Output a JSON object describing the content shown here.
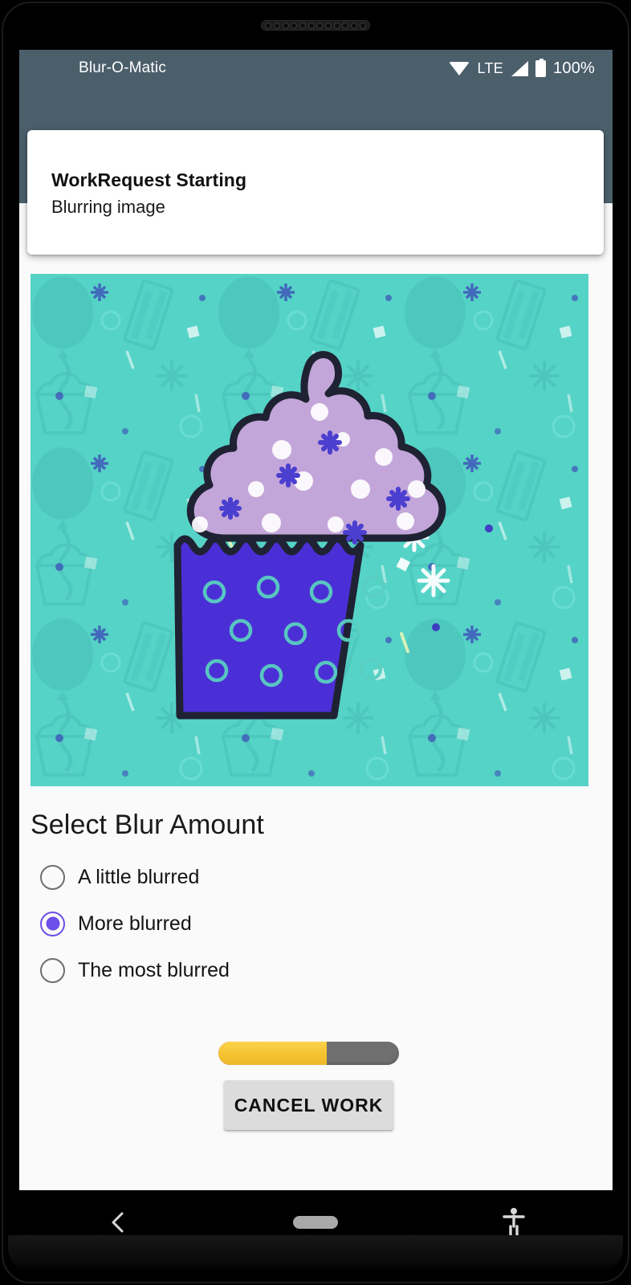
{
  "status_bar": {
    "app_title": "Blur-O-Matic",
    "network_label": "LTE",
    "battery_percent": "100%",
    "wifi_icon": "wifi-icon",
    "signal_icon": "signal-bars-icon",
    "battery_icon": "battery-full-icon",
    "background_color": "#4b5f6b"
  },
  "notification": {
    "title": "WorkRequest Starting",
    "body": "Blurring image",
    "background_color": "#ffffff"
  },
  "image_preview": {
    "alt": "cupcake-illustration",
    "background_color": "#55d3c6",
    "frosting_color": "#c3a6d9",
    "wrapper_color": "#4b2fd6",
    "outline_color": "#1f2233",
    "pattern_color": "#49c4b8"
  },
  "blur_section": {
    "heading": "Select Blur Amount",
    "options": [
      {
        "label": "A little blurred",
        "selected": false
      },
      {
        "label": "More blurred",
        "selected": true
      },
      {
        "label": "The most blurred",
        "selected": false
      }
    ],
    "selected_color": "#6c4fe8",
    "unselected_color": "#6e6e6e"
  },
  "progress": {
    "percent": 60,
    "fill_color": "#f6c331",
    "track_color": "#6f6f6f"
  },
  "actions": {
    "cancel_label": "CANCEL WORK",
    "cancel_background": "#dcdcdc"
  },
  "navigation": {
    "back_icon": "back-chevron-icon",
    "home_icon": "home-pill-icon",
    "accessibility_icon": "accessibility-icon"
  }
}
